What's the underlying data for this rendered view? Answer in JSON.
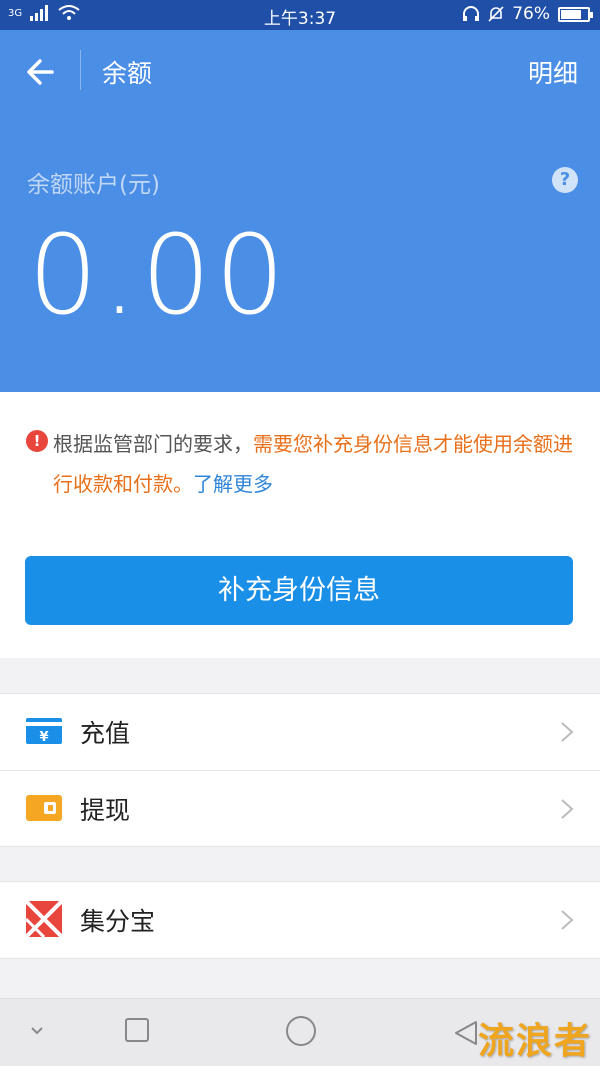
{
  "status_bar": {
    "network": "3G",
    "time": "上午3:37",
    "battery": "76%",
    "battery_level": 0.76
  },
  "header": {
    "title": "余额",
    "detail_link": "明细",
    "account_label": "余额账户(元)",
    "balance": "0.00"
  },
  "notice": {
    "prefix": "根据监管部门的要求，",
    "highlight": "需要您补充身份信息才能使用余额进行收款和付款。",
    "link": "了解更多"
  },
  "primary_button": "补充身份信息",
  "menu_group_1": [
    {
      "label": "充值",
      "icon": "recharge-card-icon"
    },
    {
      "label": "提现",
      "icon": "wallet-icon"
    }
  ],
  "menu_group_2": [
    {
      "label": "集分宝",
      "icon": "jifenbao-icon"
    }
  ],
  "watermark": "流浪者",
  "colors": {
    "header_bg": "#4a8ee6",
    "button_bg": "#1a8fe8",
    "highlight": "#e8701a",
    "link": "#2f85d8",
    "alert": "#e8453c"
  }
}
